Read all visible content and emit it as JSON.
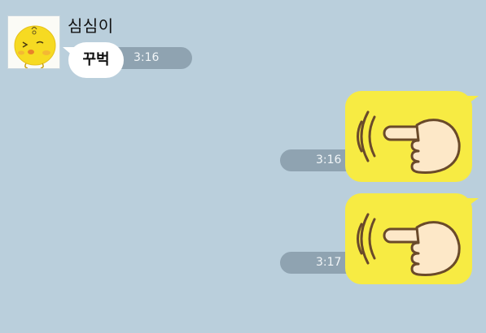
{
  "contact": {
    "name": "심심이",
    "avatar_icon": "yellow-chick-face-icon"
  },
  "messages": [
    {
      "direction": "incoming",
      "text": "꾸벅",
      "time": "3:16"
    },
    {
      "direction": "outgoing",
      "sticker": "pointing-hand-sticker",
      "time": "3:16"
    },
    {
      "direction": "outgoing",
      "sticker": "pointing-hand-sticker",
      "time": "3:17"
    }
  ],
  "colors": {
    "background": "#bacfdc",
    "incoming_bubble": "#ffffff",
    "outgoing_sticker_bg": "#f7eb43",
    "time_pill": "#8fa3b1"
  }
}
